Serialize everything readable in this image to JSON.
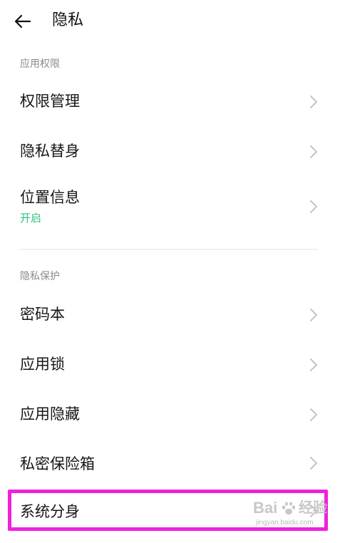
{
  "header": {
    "back_icon": "arrow-left-icon",
    "title": "隐私"
  },
  "sections": [
    {
      "label": "应用权限",
      "items": [
        {
          "label": "权限管理",
          "sub": ""
        },
        {
          "label": "隐私替身",
          "sub": ""
        },
        {
          "label": "位置信息",
          "sub": "开启"
        }
      ]
    },
    {
      "label": "隐私保护",
      "items": [
        {
          "label": "密码本",
          "sub": ""
        },
        {
          "label": "应用锁",
          "sub": ""
        },
        {
          "label": "应用隐藏",
          "sub": ""
        },
        {
          "label": "私密保险箱",
          "sub": ""
        },
        {
          "label": "系统分身",
          "sub": ""
        }
      ]
    }
  ],
  "colors": {
    "accent_green": "#2ec27e",
    "highlight_magenta": "#ee22dd",
    "section_gray": "#8a8a8a"
  },
  "watermark": {
    "brand_left": "Bai",
    "brand_right": "经验",
    "url": "jingyan.baidu.com"
  }
}
